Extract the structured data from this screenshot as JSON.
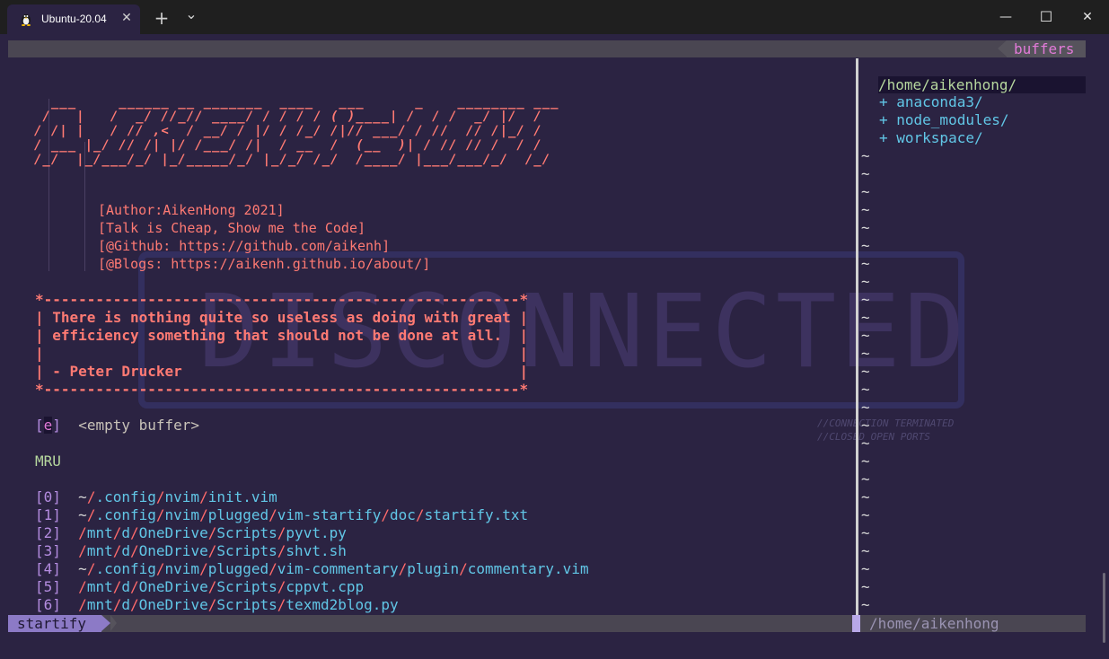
{
  "window": {
    "tab_title": "Ubuntu-20.04",
    "tab_close": "✕",
    "new_tab": "+",
    "dropdown": "⌄",
    "minimize": "—",
    "maximize": "☐",
    "close": "✕"
  },
  "nvim": {
    "top_right_label": "buffers",
    "ascii_art": [
      "  ___     ______ __ _______  ____   ___      _    ________ ___ ",
      " /   |   /  _/ //_// ____/ / / / / ( )____| /  / /  _/ |/  / ",
      "/ /| |   / // ,<  / __/ / |/ / /_/ /|// ___/ / //  // /|_/ / ",
      "/ ___ |_/ // /| |/ /___/ /|  / __  /  (__  )| / // // /  / /  ",
      "/_/  |_/___/_/ |_/_____/_/ |_/_/ /_/  /____/ |___/___/_/  /_/   "
    ],
    "header_lines": [
      "[Author:AikenHong 2021]",
      "[Talk is Cheap, Show me the Code]",
      "[@Github: https://github.com/aikenh]",
      "[@Blogs: https://aikenh.github.io/about/]"
    ],
    "quote_box": {
      "border_top": "*-------------------------------------------------------*",
      "line1": "| There is nothing quite so useless as doing with great |",
      "line2": "| efficiency something that should not be done at all.  |",
      "line3": "|                                                       |",
      "line4": "| - Peter Drucker                                       |",
      "border_bottom": "*-------------------------------------------------------*"
    },
    "empty_buffer": {
      "key_open": "[",
      "key": "e",
      "key_close": "]",
      "label": "<empty buffer>"
    },
    "mru_title": "MRU",
    "mru": [
      {
        "idx": "[0]",
        "parts": [
          "~",
          "/",
          ".config",
          "/",
          "nvim",
          "/",
          "init.vim"
        ]
      },
      {
        "idx": "[1]",
        "parts": [
          "~",
          "/",
          ".config",
          "/",
          "nvim",
          "/",
          "plugged",
          "/",
          "vim-startify",
          "/",
          "doc",
          "/",
          "startify.txt"
        ]
      },
      {
        "idx": "[2]",
        "parts": [
          "",
          "/",
          "mnt",
          "/",
          "d",
          "/",
          "OneDrive",
          "/",
          "Scripts",
          "/",
          "pyvt.py"
        ]
      },
      {
        "idx": "[3]",
        "parts": [
          "",
          "/",
          "mnt",
          "/",
          "d",
          "/",
          "OneDrive",
          "/",
          "Scripts",
          "/",
          "shvt.sh"
        ]
      },
      {
        "idx": "[4]",
        "parts": [
          "~",
          "/",
          ".config",
          "/",
          "nvim",
          "/",
          "plugged",
          "/",
          "vim-commentary",
          "/",
          "plugin",
          "/",
          "commentary.vim"
        ]
      },
      {
        "idx": "[5]",
        "parts": [
          "",
          "/",
          "mnt",
          "/",
          "d",
          "/",
          "OneDrive",
          "/",
          "Scripts",
          "/",
          "cppvt.cpp"
        ]
      },
      {
        "idx": "[6]",
        "parts": [
          "",
          "/",
          "mnt",
          "/",
          "d",
          "/",
          "OneDrive",
          "/",
          "Scripts",
          "/",
          "texmd2blog.py"
        ]
      }
    ],
    "watermark_text": "DISCONNECTED",
    "watermark_note": "//CONNECTION TERMINATED\n//CLOSED OPEN PORTS",
    "tree": {
      "root": "/home/aikenhong/",
      "items": [
        "+ anaconda3/",
        "+ node_modules/",
        "+ workspace/"
      ]
    },
    "tilde": "~",
    "status_mode": "startify",
    "status_path": "/home/aikenhong"
  },
  "colors": {
    "background": "#2b2342",
    "banner": "#ff7a73",
    "path_dir": "#61c6e6",
    "path_sep": "#ff6b6b",
    "mode_bg": "#8c7ac6",
    "buffers_label": "#e27ad8"
  }
}
